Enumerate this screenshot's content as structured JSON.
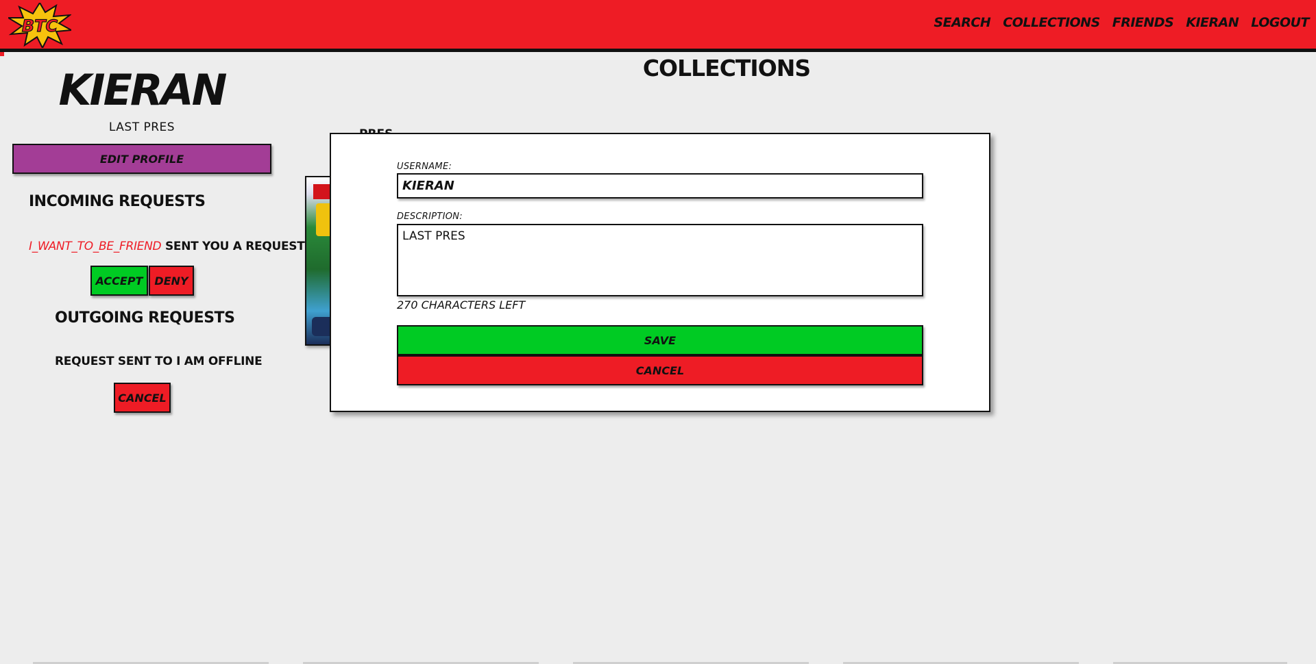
{
  "header": {
    "logo_text": "BTC",
    "nav": [
      "SEARCH",
      "COLLECTIONS",
      "FRIENDS",
      "KIERAN",
      "LOGOUT"
    ]
  },
  "page_title": "COLLECTIONS",
  "profile": {
    "name": "KIERAN",
    "description": "LAST PRES",
    "edit_button": "EDIT PROFILE"
  },
  "incoming": {
    "heading": "INCOMING REQUESTS",
    "requests": [
      {
        "user": "I_WANT_TO_BE_FRIEND",
        "suffix": " SENT YOU A REQUEST",
        "accept": "ACCEPT",
        "deny": "DENY"
      }
    ]
  },
  "outgoing": {
    "heading": "OUTGOING REQUESTS",
    "requests": [
      {
        "text": "REQUEST SENT TO I AM OFFLINE",
        "cancel": "CANCEL"
      }
    ]
  },
  "collection_behind": {
    "label": "PRES"
  },
  "modal": {
    "username_label": "USERNAME:",
    "username_value": "KIERAN",
    "description_label": "DESCRIPTION:",
    "description_value": "LAST PRES",
    "chars_left": "270 CHARACTERS LEFT",
    "save": "SAVE",
    "cancel": "CANCEL"
  },
  "colors": {
    "brand_red": "#ee1c25",
    "accept_green": "#00cb23",
    "edit_purple": "#a33d96",
    "background": "#ededed"
  }
}
